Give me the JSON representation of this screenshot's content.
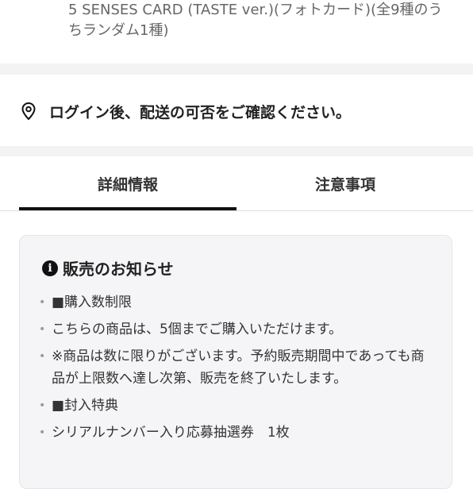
{
  "product": {
    "title": "5 SENSES CARD (TASTE ver.)(フォトカード)(全9種のうちランダム1種)"
  },
  "delivery": {
    "icon": "location-pin-icon",
    "text": "ログイン後、配送の可否をご確認ください。"
  },
  "tabs": [
    {
      "label": "詳細情報",
      "active": true
    },
    {
      "label": "注意事項",
      "active": false
    }
  ],
  "notice": {
    "icon": "info-icon",
    "icon_glyph": "i",
    "title": "販売のお知らせ",
    "items": [
      "■購入数制限",
      "こちらの商品は、5個までご購入いただけます。",
      "※商品は数に限りがございます。予約販売期間中であっても商品が上限数へ達し次第、販売を終了いたします。",
      "■封入特典",
      "シリアルナンバー入り応募抽選券　1枚"
    ]
  },
  "colors": {
    "accent": "#111111",
    "separator": "#f3f3f3",
    "notice_bg": "#f5f5f7"
  }
}
